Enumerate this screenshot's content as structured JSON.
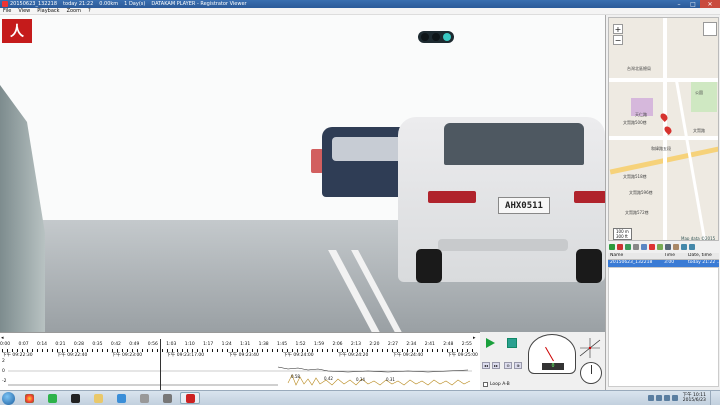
{
  "window": {
    "title_segments": [
      "20150623_132218",
      "today 21:22",
      "0.00km",
      "1 Day(s)",
      "DATAKAM PLAYER - Registrator Viewer"
    ],
    "minimize": "–",
    "maximize": "□",
    "close": "✕"
  },
  "menu": [
    "File",
    "View",
    "Playback",
    "Zoom",
    "?"
  ],
  "video": {
    "logo_text": "人",
    "license_plate": "AHX0511"
  },
  "timeline": {
    "scroll_left": "◂",
    "scroll_right": "▸",
    "offsets": [
      "0:00",
      "0:07",
      "0:14",
      "0:21",
      "0:28",
      "0:35",
      "0:42",
      "0:49",
      "0:56",
      "1:03",
      "1:10",
      "1:17",
      "1:24",
      "1:31",
      "1:38",
      "1:45",
      "1:52",
      "1:59",
      "2:06",
      "2:13",
      "2:20",
      "2:27",
      "2:34",
      "2:41",
      "2:48",
      "2:55"
    ],
    "clock_times": [
      "下午 09:22:30",
      "下午 09:22:40",
      "下午 09:23:00",
      "下午 09:23:17.00",
      "下午 09:23:40",
      "下午 09:24:00",
      "下午 09:24:20",
      "下午 09:24:40",
      "下午 09:25:00"
    ],
    "y_axis": [
      "2",
      "0",
      "-2"
    ],
    "value_labels": [
      "0.58",
      "0.42",
      "0.34",
      "0.31"
    ]
  },
  "controls": {
    "loop_label": "Loop A-B",
    "speed_readout": "0",
    "small_buttons": [
      "◂◂",
      "▸▸",
      "⊖",
      "⊕"
    ]
  },
  "map": {
    "zoom_in": "+",
    "zoom_out": "−",
    "labels": [
      "台灣北區總局",
      "文賢路500巷",
      "文賢路518巷",
      "文賢路596巷",
      "文賢路572巷",
      "和緯路五段",
      "文賢路",
      "天仁路",
      "公園"
    ],
    "scale": [
      "100 m",
      "300 ft"
    ],
    "credit": "Map data ©2015"
  },
  "list": {
    "headers": [
      "Name",
      "Time",
      "Date, time"
    ],
    "rows": [
      {
        "name": "20150623_132218",
        "time": "3:00",
        "date": "today 21:22 ..."
      }
    ]
  },
  "taskbar": {
    "clock_time": "下午 10:11",
    "clock_date": "2015/6/23"
  }
}
